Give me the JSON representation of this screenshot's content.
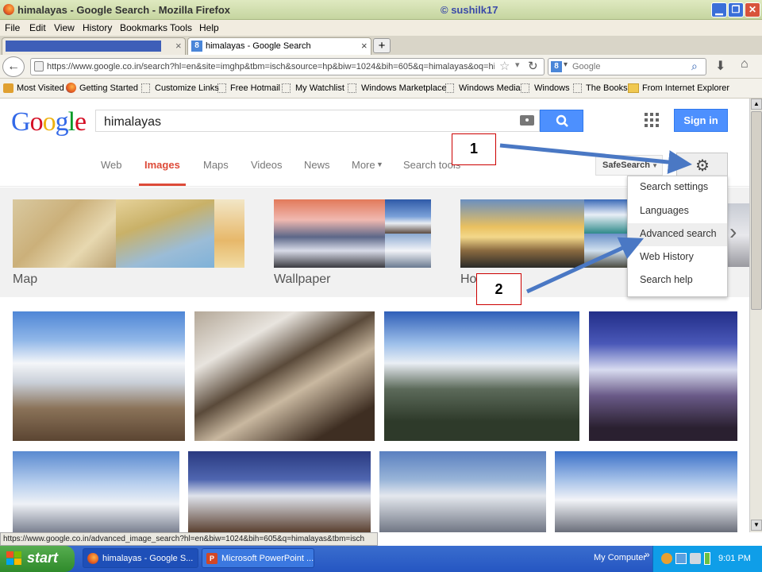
{
  "window": {
    "title": "himalayas - Google Search - Mozilla Firefox",
    "watermark": "© sushilk17"
  },
  "menu": [
    "File",
    "Edit",
    "View",
    "History",
    "Bookmarks",
    "Tools",
    "Help"
  ],
  "tabs": {
    "active": "himalayas - Google Search",
    "close": "×",
    "new": "+"
  },
  "address": {
    "url": "https://www.google.co.in/search?hl=en&site=imghp&tbm=isch&source=hp&biw=1024&bih=605&q=himalayas&oq=himalya&g",
    "search_placeholder": "Google"
  },
  "bookmarks": [
    "Most Visited",
    "Getting Started",
    "Customize Links",
    "Free Hotmail",
    "My Watchlist",
    "Windows Marketplace",
    "Windows Media",
    "Windows",
    "The Books",
    "From Internet Explorer"
  ],
  "google": {
    "logo": [
      "G",
      "o",
      "o",
      "g",
      "l",
      "e"
    ],
    "logo_colors": [
      "#3369e8",
      "#d50f25",
      "#eeb211",
      "#3369e8",
      "#009925",
      "#d50f25"
    ],
    "query": "himalayas",
    "signin": "Sign in",
    "nav": [
      "Web",
      "Images",
      "Maps",
      "Videos",
      "News",
      "More",
      "Search tools"
    ],
    "safesearch": "SafeSearch",
    "related": [
      "Map",
      "Wallpaper",
      "Ho"
    ],
    "settings_menu": [
      "Search settings",
      "Languages",
      "Advanced search",
      "Web History",
      "Search help"
    ]
  },
  "annotations": [
    "1",
    "2"
  ],
  "status_url": "https://www.google.co.in/advanced_image_search?hl=en&biw=1024&bih=605&q=himalayas&tbm=isch",
  "taskbar": {
    "start": "start",
    "tasks": [
      "himalayas - Google S...",
      "Microsoft PowerPoint ..."
    ],
    "tray_label": "My Computer",
    "time": "9:01 PM"
  },
  "colors": {
    "accent_blue": "#4d90fe",
    "active_nav": "#dd4b39",
    "arrow": "#4a78c4"
  }
}
